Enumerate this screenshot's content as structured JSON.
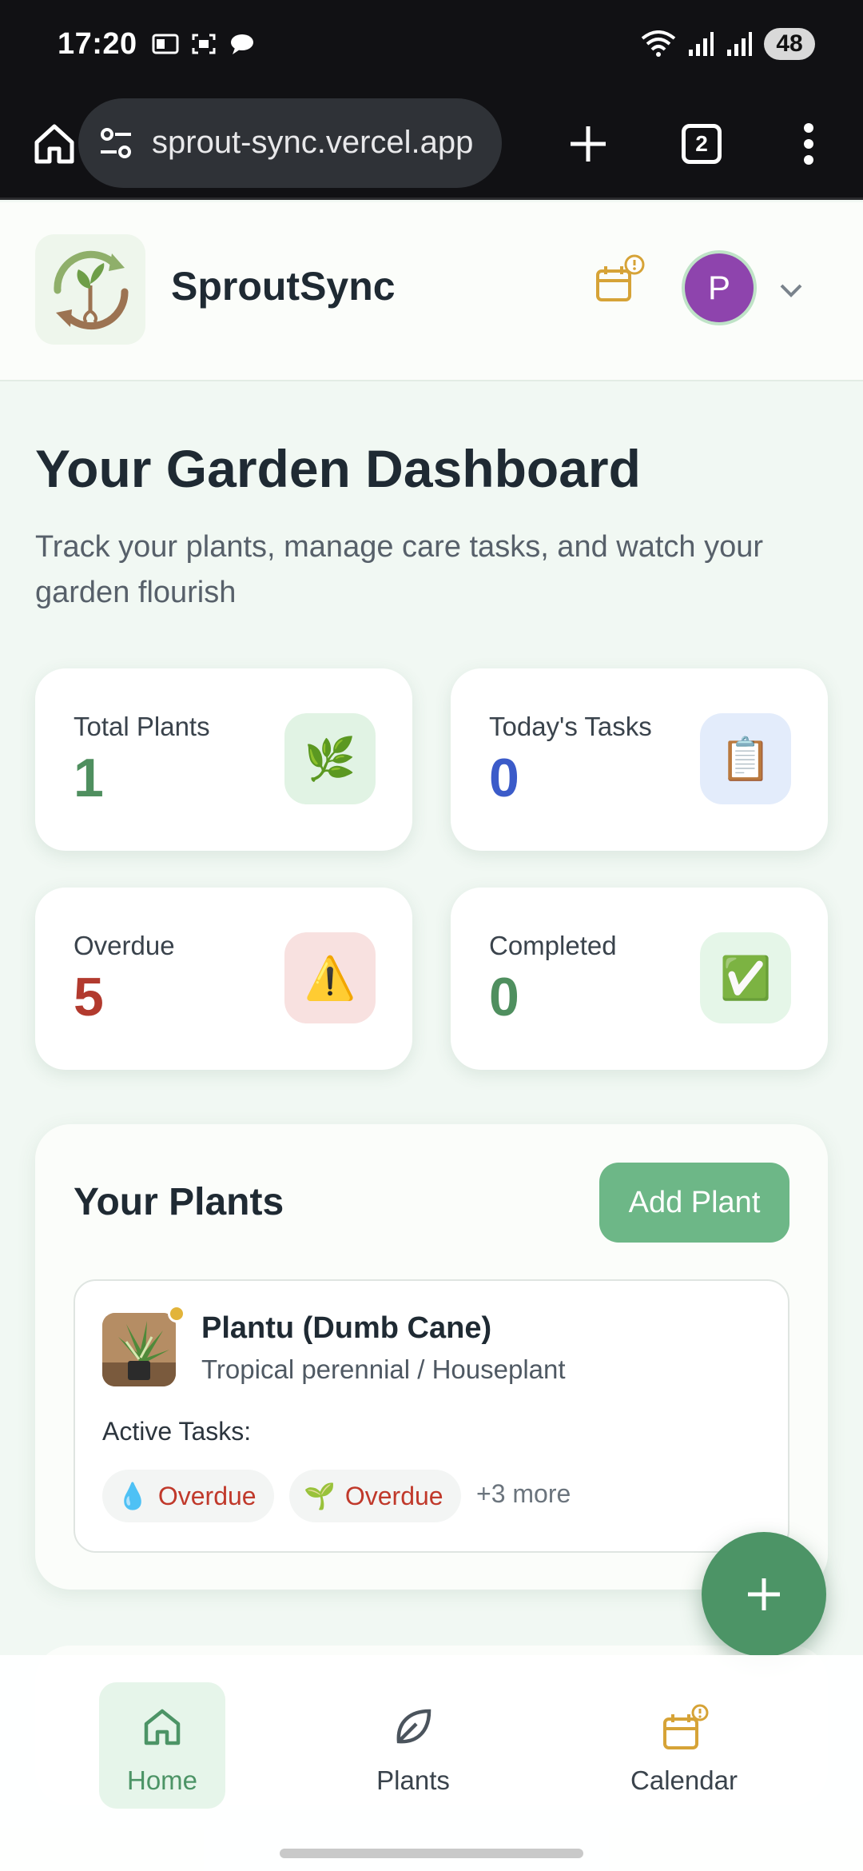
{
  "status_bar": {
    "time": "17:20",
    "battery": "48"
  },
  "browser": {
    "url": "sprout-sync.vercel.app",
    "tab_count": "2"
  },
  "header": {
    "brand": "SproutSync",
    "avatar_initial": "P"
  },
  "dashboard": {
    "title": "Your Garden Dashboard",
    "subtitle": "Track your plants, manage care tasks, and watch your garden flourish"
  },
  "stats": [
    {
      "label": "Total Plants",
      "value": "1",
      "icon": "🌿",
      "value_color": "#4f8f5f",
      "icon_bg": "#e1f3e4"
    },
    {
      "label": "Today's Tasks",
      "value": "0",
      "icon": "📋",
      "value_color": "#3b5bc9",
      "icon_bg": "#e3ecfb"
    },
    {
      "label": "Overdue",
      "value": "5",
      "icon": "⚠️",
      "value_color": "#b23a2e",
      "icon_bg": "#f8e1e0"
    },
    {
      "label": "Completed",
      "value": "0",
      "icon": "✅",
      "value_color": "#4f8f5f",
      "icon_bg": "#e5f6e8"
    }
  ],
  "plants_panel": {
    "title": "Your Plants",
    "add_button": "Add Plant",
    "plants": [
      {
        "name": "Plantu (Dumb Cane)",
        "type": "Tropical perennial / Houseplant",
        "active_tasks_label": "Active Tasks:",
        "tasks": [
          {
            "icon": "💧",
            "status": "Overdue"
          },
          {
            "icon": "🌱",
            "status": "Overdue"
          }
        ],
        "more": "+3 more"
      }
    ]
  },
  "bottom_nav": [
    {
      "label": "Home",
      "active": true
    },
    {
      "label": "Plants",
      "active": false
    },
    {
      "label": "Calendar",
      "active": false
    }
  ],
  "colors": {
    "accent": "#6db787",
    "fab": "#4c9466",
    "warning": "#d6a337"
  }
}
